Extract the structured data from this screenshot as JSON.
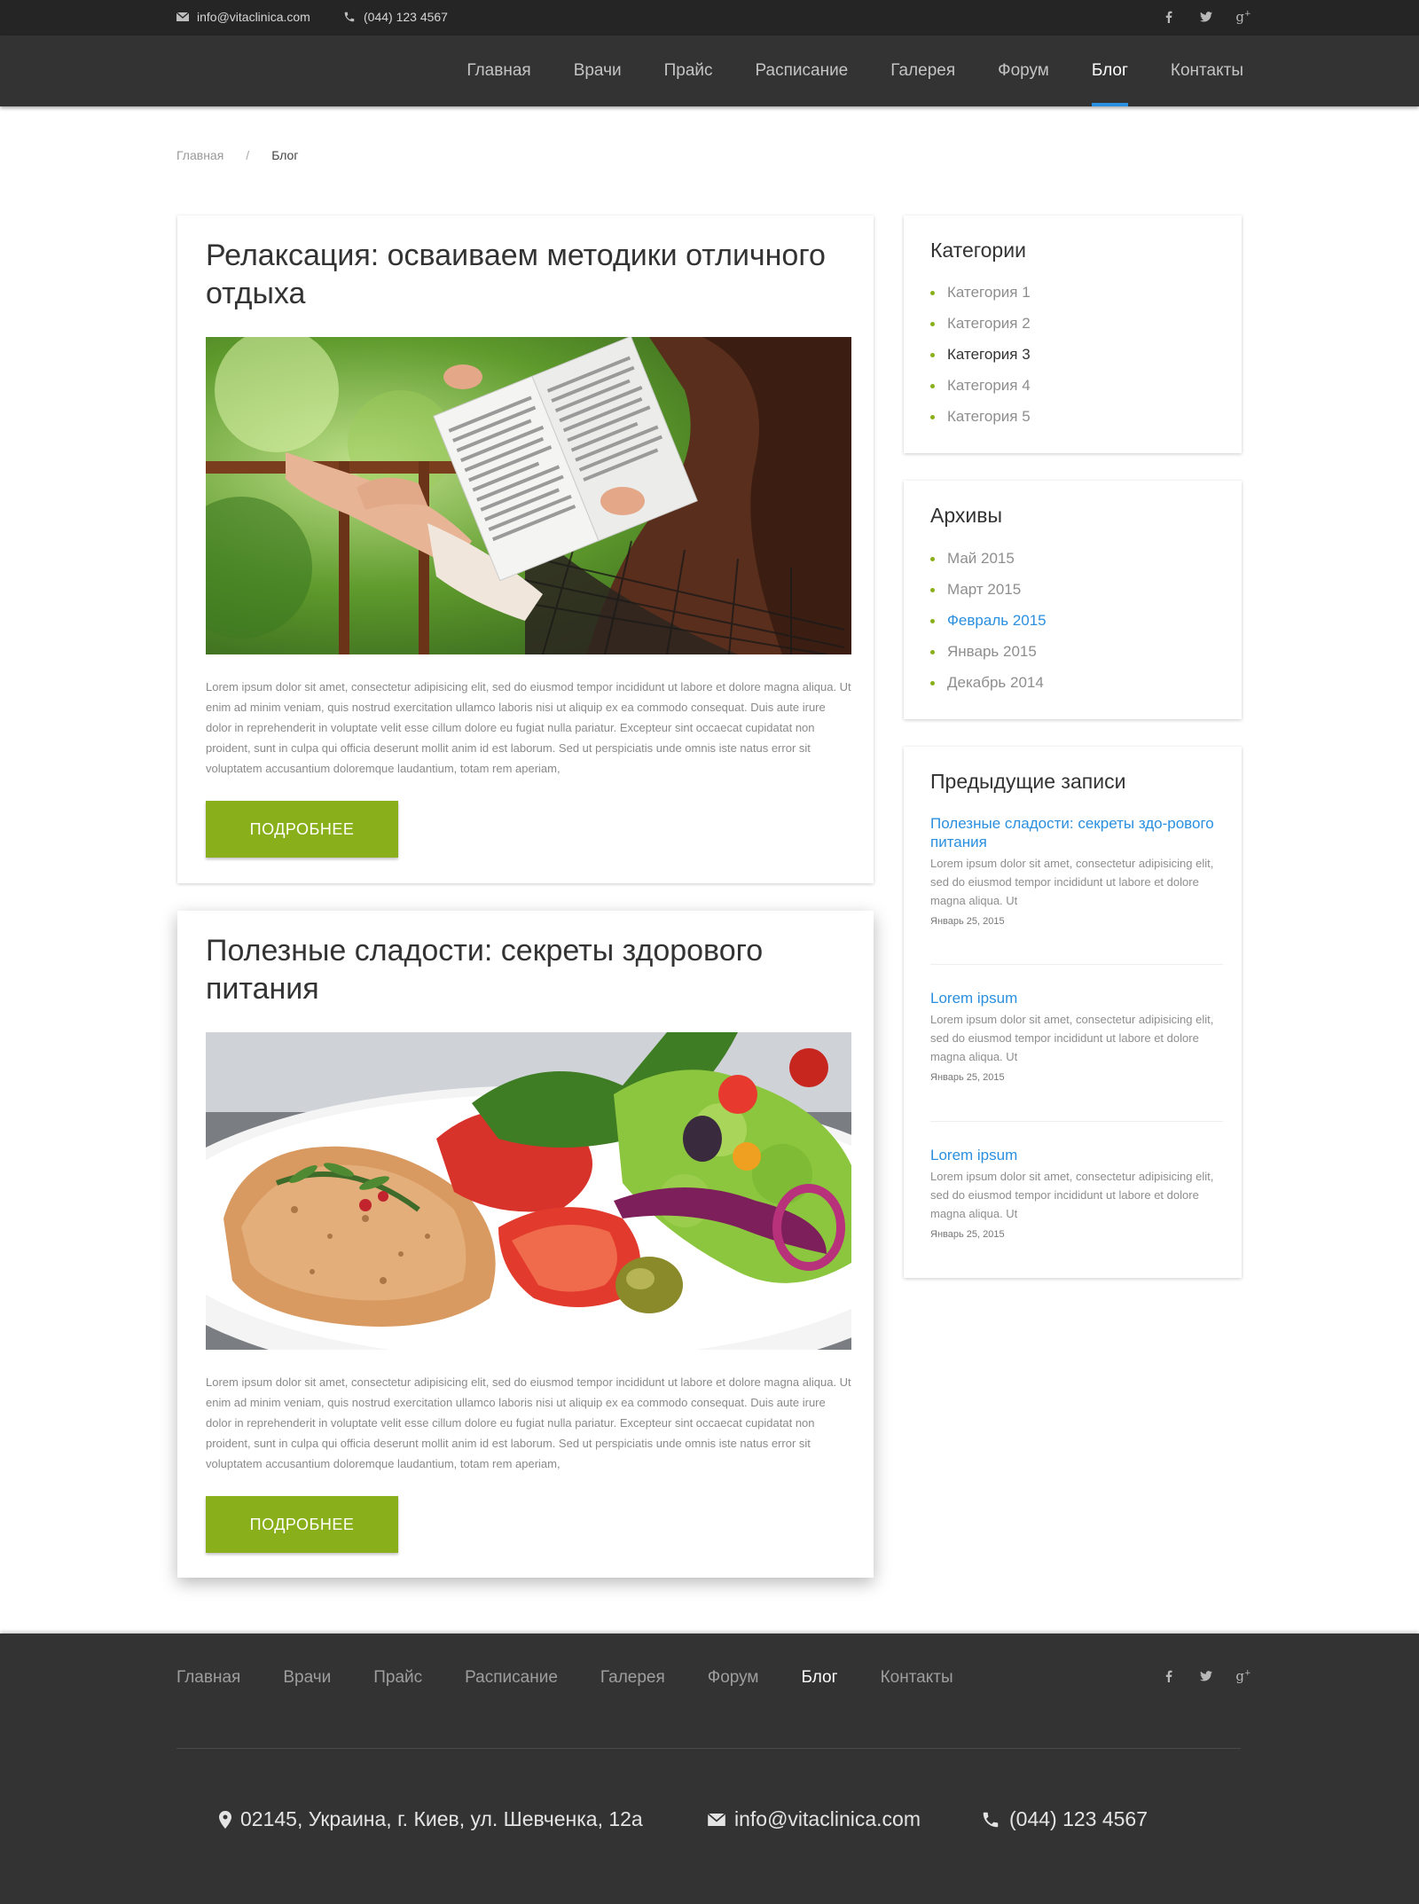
{
  "topbar": {
    "email": "info@vitaclinica.com",
    "phone": "(044) 123 4567",
    "social": [
      "facebook-icon",
      "twitter-icon",
      "google-plus-icon"
    ]
  },
  "nav": {
    "items": [
      "Главная",
      "Врачи",
      "Прайс",
      "Расписание",
      "Галерея",
      "Форум",
      "Блог",
      "Контакты"
    ],
    "active": "Блог"
  },
  "breadcrumb": {
    "home": "Главная",
    "separator": "/",
    "current": "Блог"
  },
  "posts": [
    {
      "title": "Релаксация: осваиваем методики отличного отдыха",
      "excerpt": "Lorem ipsum dolor sit amet, consectetur adipisicing elit, sed do eiusmod tempor incididunt ut labore et dolore magna aliqua. Ut enim ad minim veniam, quis nostrud exercitation ullamco laboris nisi ut aliquip ex ea commodo consequat. Duis aute irure dolor in reprehenderit in voluptate velit esse cillum dolore eu fugiat nulla pariatur. Excepteur sint occaecat cupidatat non proident, sunt in culpa qui officia deserunt mollit anim id est laborum. Sed ut perspiciatis unde omnis iste natus error sit voluptatem accusantium doloremque laudantium, totam rem aperiam,",
      "button": "ПОДРОБНЕЕ"
    },
    {
      "title": "Полезные сладости: секреты здорового питания",
      "excerpt": "Lorem ipsum dolor sit amet, consectetur adipisicing elit, sed do eiusmod tempor incididunt ut labore et dolore magna aliqua. Ut enim ad minim veniam, quis nostrud exercitation ullamco laboris nisi ut aliquip ex ea commodo consequat. Duis aute irure dolor in reprehenderit in voluptate velit esse cillum dolore eu fugiat nulla pariatur. Excepteur sint occaecat cupidatat non proident, sunt in culpa qui officia deserunt mollit anim id est laborum. Sed ut perspiciatis unde omnis iste natus error sit voluptatem accusantium doloremque laudantium, totam rem aperiam,",
      "button": "ПОДРОБНЕЕ"
    }
  ],
  "sidebar": {
    "categories": {
      "title": "Категории",
      "items": [
        "Категория 1",
        "Категория 2",
        "Категория 3",
        "Категория 4",
        "Категория 5"
      ],
      "highlighted": "Категория 3"
    },
    "archives": {
      "title": "Архивы",
      "items": [
        "Май 2015",
        "Март 2015",
        "Февраль 2015",
        "Январь 2015",
        "Декабрь 2014"
      ],
      "highlighted": "Февраль 2015"
    },
    "recent": {
      "title": "Предыдущие записи",
      "items": [
        {
          "title": "Полезные сладости: секреты здо-рового питания",
          "text": "Lorem ipsum dolor sit amet, consectetur adipisicing elit, sed do eiusmod tempor incididunt ut labore et dolore magna aliqua. Ut",
          "date": "Январь 25, 2015"
        },
        {
          "title": "Lorem ipsum",
          "text": "Lorem ipsum dolor sit amet, consectetur adipisicing elit, sed do eiusmod tempor incididunt ut labore et dolore magna aliqua. Ut",
          "date": "Январь 25, 2015"
        },
        {
          "title": "Lorem ipsum",
          "text": "Lorem ipsum dolor sit amet, consectetur adipisicing elit, sed do eiusmod tempor incididunt ut labore et dolore magna aliqua. Ut",
          "date": "Январь 25, 2015"
        }
      ]
    }
  },
  "footer": {
    "nav": [
      "Главная",
      "Врачи",
      "Прайс",
      "Расписание",
      "Галерея",
      "Форум",
      "Блог",
      "Контакты"
    ],
    "active": "Блог",
    "address": "02145, Украина, г. Киев, ул. Шевченка, 12а",
    "email": "info@vitaclinica.com",
    "phone": "(044) 123 4567"
  },
  "colors": {
    "accent_green": "#89b01a",
    "accent_blue": "#2a8fdf",
    "dark_bg": "#333333",
    "topbar_bg": "#252525"
  }
}
